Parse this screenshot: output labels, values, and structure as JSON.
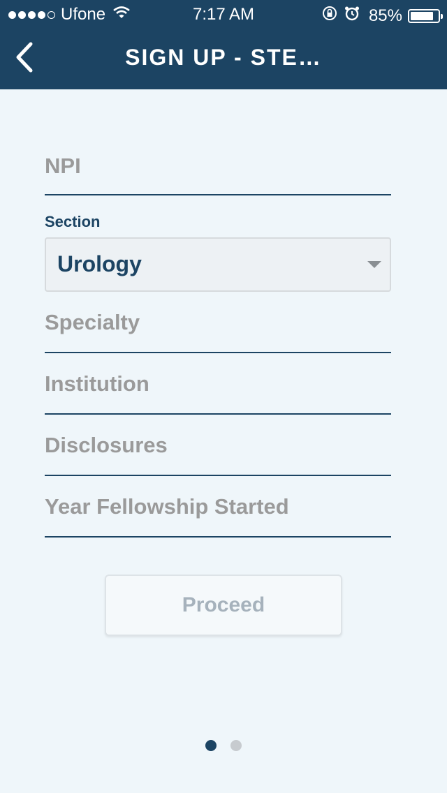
{
  "status_bar": {
    "carrier": "Ufone",
    "time": "7:17 AM",
    "battery": "85%",
    "battery_level": 0.85,
    "signal_bars": 4,
    "signal_bars_total": 5
  },
  "header": {
    "title": "SIGN UP - STE…",
    "back_icon": "chevron-left-icon"
  },
  "form": {
    "npi_placeholder": "NPI",
    "section_label": "Section",
    "section_value": "Urology",
    "specialty_placeholder": "Specialty",
    "institution_placeholder": "Institution",
    "disclosures_placeholder": "Disclosures",
    "year_placeholder": "Year Fellowship Started"
  },
  "actions": {
    "proceed_label": "Proceed"
  },
  "pager": {
    "current": 1,
    "total": 2
  },
  "colors": {
    "header": "#1c4463",
    "background": "#eff6fa",
    "placeholder": "#9a9a9a",
    "accent": "#1c4463"
  }
}
